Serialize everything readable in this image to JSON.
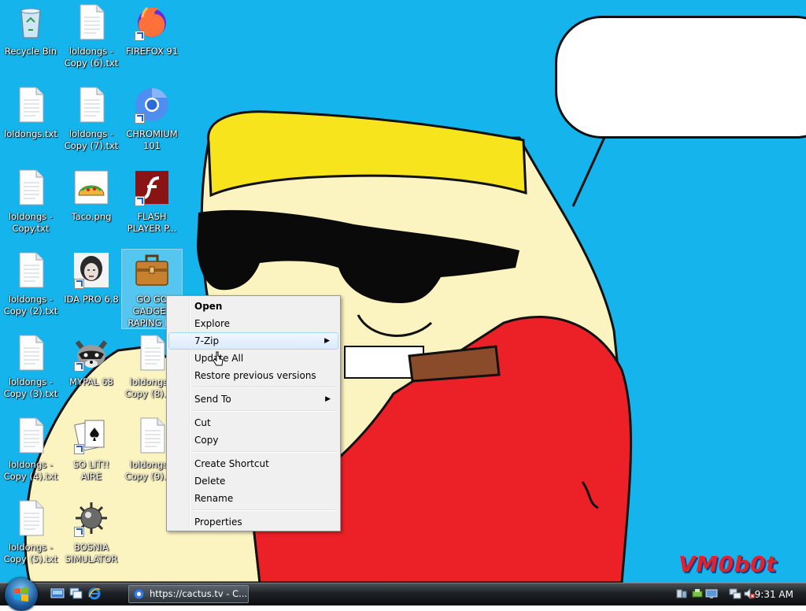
{
  "desktop": {
    "background_color": "#16b4ec",
    "icons": [
      {
        "label": "Recycle Bin",
        "icon": "recycle-bin-icon",
        "shortcut": false
      },
      {
        "label": "loldongs - Copy (6).txt",
        "icon": "text-file-icon",
        "shortcut": false
      },
      {
        "label": "FIREFOX 91",
        "icon": "firefox-icon",
        "shortcut": true
      },
      {
        "label": "loldongs.txt",
        "icon": "text-file-icon",
        "shortcut": false
      },
      {
        "label": "loldongs - Copy (7).txt",
        "icon": "text-file-icon",
        "shortcut": false
      },
      {
        "label": "CHROMIUM 101",
        "icon": "chromium-icon",
        "shortcut": true
      },
      {
        "label": "loldongs - Copy.txt",
        "icon": "text-file-icon",
        "shortcut": false
      },
      {
        "label": "Taco.png",
        "icon": "taco-image-icon",
        "shortcut": false
      },
      {
        "label": "FLASH PLAYER P...",
        "icon": "flash-player-icon",
        "shortcut": true
      },
      {
        "label": "loldongs - Copy (2).txt",
        "icon": "text-file-icon",
        "shortcut": false
      },
      {
        "label": "IDA PRO 6.8",
        "icon": "ida-pro-icon",
        "shortcut": true
      },
      {
        "label": "GO GO GADGET RAPING I...",
        "icon": "briefcase-icon",
        "shortcut": false,
        "selected": true
      },
      {
        "label": "loldongs - Copy (3).txt",
        "icon": "text-file-icon",
        "shortcut": false
      },
      {
        "label": "MYPAL 68",
        "icon": "raccoon-icon",
        "shortcut": true
      },
      {
        "label": "loldongs - Copy (8).txt",
        "icon": "text-file-icon",
        "shortcut": false
      },
      {
        "label": "loldongs - Copy (4).txt",
        "icon": "text-file-icon",
        "shortcut": false
      },
      {
        "label": "SO LIT!! AIRE",
        "icon": "solitaire-cards-icon",
        "shortcut": true
      },
      {
        "label": "loldongs - Copy (9).txt",
        "icon": "text-file-icon",
        "shortcut": false
      },
      {
        "label": "loldongs - Copy (5).txt",
        "icon": "text-file-icon",
        "shortcut": false
      },
      {
        "label": "BOSNIA SIMULATOR",
        "icon": "mine-icon",
        "shortcut": true
      }
    ],
    "signature": "VM0b0t",
    "signature_color": "#e5202b"
  },
  "context_menu": {
    "groups": [
      [
        {
          "label": "Open",
          "default": true
        },
        {
          "label": "Explore"
        },
        {
          "label": "7-Zip",
          "submenu": true,
          "hover": true
        },
        {
          "label": "Update All"
        },
        {
          "label": "Restore previous versions"
        }
      ],
      [
        {
          "label": "Send To",
          "submenu": true
        }
      ],
      [
        {
          "label": "Cut"
        },
        {
          "label": "Copy"
        }
      ],
      [
        {
          "label": "Create Shortcut"
        },
        {
          "label": "Delete"
        },
        {
          "label": "Rename"
        }
      ],
      [
        {
          "label": "Properties"
        }
      ]
    ]
  },
  "taskbar": {
    "start_button_icon": "windows-logo-icon",
    "quick_launch": [
      "show-desktop-icon",
      "switch-windows-icon",
      "internet-explorer-icon"
    ],
    "open_task": {
      "label": "https://cactus.tv - C...",
      "icon": "chromium-icon"
    },
    "tray_icons": [
      "network-icon",
      "safely-remove-icon",
      "display-icon",
      "network-connection-icon",
      "volume-muted-icon"
    ],
    "clock": "9:31 AM"
  }
}
